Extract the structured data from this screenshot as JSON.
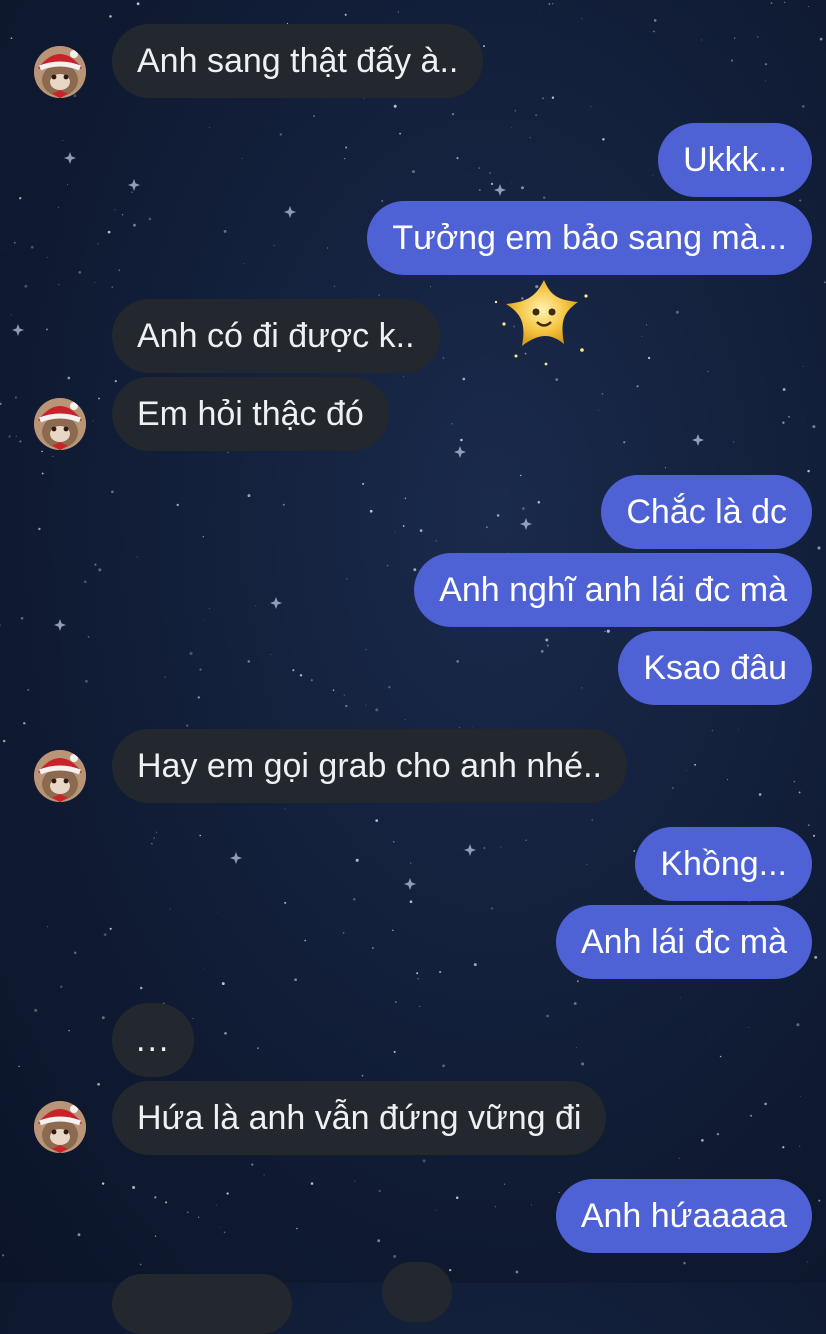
{
  "conversation": {
    "messages": [
      {
        "side": "in",
        "text": "Anh sang thật đấy à.."
      },
      {
        "side": "out",
        "text": "Ukkk..."
      },
      {
        "side": "out",
        "text": "Tưởng em bảo sang mà..."
      },
      {
        "side": "in",
        "text": "Anh có đi được k.."
      },
      {
        "side": "in",
        "text": "Em hỏi thậc đó"
      },
      {
        "side": "out",
        "text": "Chắc là dc"
      },
      {
        "side": "out",
        "text": "Anh nghĩ anh lái đc mà"
      },
      {
        "side": "out",
        "text": "Ksao đâu"
      },
      {
        "side": "in",
        "text": "Hay em gọi grab cho anh nhé.."
      },
      {
        "side": "out",
        "text": "Khồng..."
      },
      {
        "side": "out",
        "text": "Anh lái đc mà"
      },
      {
        "side": "in",
        "text": "..."
      },
      {
        "side": "in",
        "text": "Hứa là anh vẫn đứng vững đi"
      },
      {
        "side": "out",
        "text": "Anh hứaaaaa"
      }
    ]
  },
  "sticker": {
    "icon": "star-sticker-icon"
  },
  "colors": {
    "incoming_bubble": "#23282e",
    "outgoing_bubble": "#4e62d6",
    "background": "#111d36"
  }
}
